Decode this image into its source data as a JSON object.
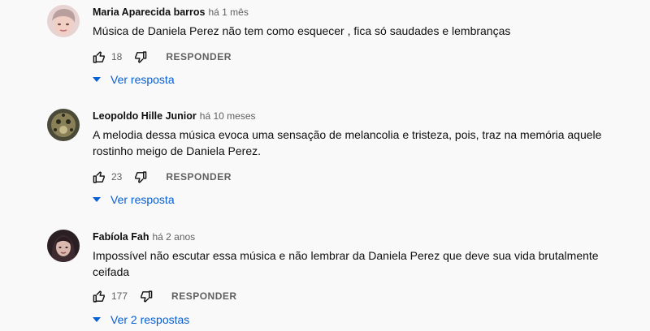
{
  "comments": [
    {
      "author": "Maria Aparecida barros",
      "time": "há 1 mês",
      "text": "Música de Daniela Perez não tem como esquecer , fica só saudades e lembranças",
      "likes": "18",
      "reply_label": "RESPONDER",
      "replies_label": "Ver resposta",
      "avatar_color": "#d9b2b8"
    },
    {
      "author": "Leopoldo Hille Junior",
      "time": "há 10 meses",
      "text": "A melodia dessa música evoca uma sensação de melancolia e tristeza, pois, traz na memória aquele rostinho meigo de Daniela Perez.",
      "likes": "23",
      "reply_label": "RESPONDER",
      "replies_label": "Ver resposta",
      "avatar_color": "#6b6a4e"
    },
    {
      "author": "Fabíola Fah",
      "time": "há 2 anos",
      "text": "Impossível não escutar essa música  e não lembrar da Daniela Perez que deve sua vida brutalmente ceifada",
      "likes": "177",
      "reply_label": "RESPONDER",
      "replies_label": "Ver 2 respostas",
      "avatar_color": "#3a2c2e"
    }
  ],
  "icons": {
    "like": "thumbs-up-icon",
    "dislike": "thumbs-down-icon",
    "expand": "caret-down-icon"
  },
  "colors": {
    "background": "#f9f9f9",
    "link": "#065fd4",
    "secondary_text": "#606060"
  }
}
